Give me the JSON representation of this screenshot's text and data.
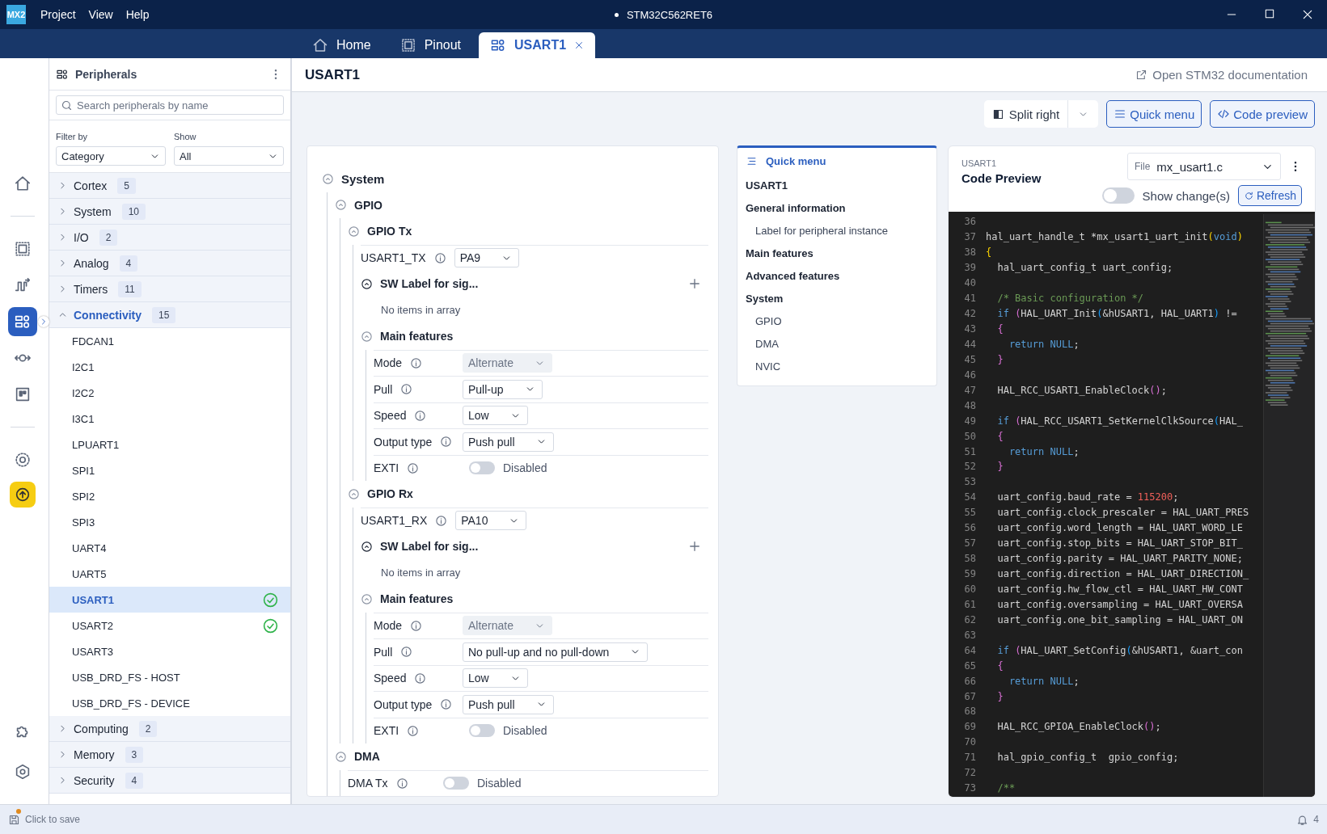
{
  "titlebar": {
    "logo": "MX2",
    "menu": [
      "Project",
      "View",
      "Help"
    ],
    "unsaved": true,
    "title": "STM32C562RET6"
  },
  "tabs": [
    {
      "label": "Home",
      "kind": "home",
      "selected": false,
      "closable": false
    },
    {
      "label": "Pinout",
      "kind": "chip",
      "selected": false,
      "closable": false
    },
    {
      "label": "USART1",
      "kind": "blocks",
      "selected": true,
      "closable": true
    }
  ],
  "rail": {
    "top": [
      {
        "kind": "home",
        "selected": false
      }
    ],
    "middle": [
      {
        "kind": "chip",
        "selected": false
      },
      {
        "kind": "wave",
        "selected": false
      },
      {
        "kind": "blocks",
        "selected": true
      },
      {
        "kind": "connector",
        "selected": false
      },
      {
        "kind": "board",
        "selected": false
      }
    ],
    "tools": [
      {
        "kind": "gear",
        "selected": false
      },
      {
        "kind": "upload",
        "selected": false
      }
    ],
    "bottom": [
      {
        "kind": "puzzle",
        "selected": false
      },
      {
        "kind": "hexagon",
        "selected": false
      }
    ]
  },
  "peripherals": {
    "title": "Peripherals",
    "search": {
      "placeholder": "Search peripherals by name"
    },
    "filter_by": {
      "label": "Filter by",
      "value": "Category"
    },
    "show": {
      "label": "Show",
      "value": "All"
    },
    "categories": [
      {
        "label": "Cortex",
        "count": "5",
        "expanded": false
      },
      {
        "label": "System",
        "count": "10",
        "expanded": false
      },
      {
        "label": "I/O",
        "count": "2",
        "expanded": false
      },
      {
        "label": "Analog",
        "count": "4",
        "expanded": false
      },
      {
        "label": "Timers",
        "count": "11",
        "expanded": false
      },
      {
        "label": "Connectivity",
        "count": "15",
        "expanded": true,
        "children": [
          {
            "label": "FDCAN1",
            "selected": false,
            "configured": false
          },
          {
            "label": "I2C1",
            "selected": false,
            "configured": false
          },
          {
            "label": "I2C2",
            "selected": false,
            "configured": false
          },
          {
            "label": "I3C1",
            "selected": false,
            "configured": false
          },
          {
            "label": "LPUART1",
            "selected": false,
            "configured": false
          },
          {
            "label": "SPI1",
            "selected": false,
            "configured": false
          },
          {
            "label": "SPI2",
            "selected": false,
            "configured": false
          },
          {
            "label": "SPI3",
            "selected": false,
            "configured": false
          },
          {
            "label": "UART4",
            "selected": false,
            "configured": false
          },
          {
            "label": "UART5",
            "selected": false,
            "configured": false
          },
          {
            "label": "USART1",
            "selected": true,
            "configured": true
          },
          {
            "label": "USART2",
            "selected": false,
            "configured": true
          },
          {
            "label": "USART3",
            "selected": false,
            "configured": false
          },
          {
            "label": "USB_DRD_FS - HOST",
            "selected": false,
            "configured": false
          },
          {
            "label": "USB_DRD_FS - DEVICE",
            "selected": false,
            "configured": false
          }
        ]
      },
      {
        "label": "Computing",
        "count": "2",
        "expanded": false
      },
      {
        "label": "Memory",
        "count": "3",
        "expanded": false
      },
      {
        "label": "Security",
        "count": "4",
        "expanded": false
      }
    ]
  },
  "page": {
    "title": "USART1",
    "doc_link": "Open STM32 documentation"
  },
  "toolbar": {
    "split": "Split right",
    "quick_menu": "Quick menu",
    "code_preview": "Code preview"
  },
  "config_tree": [
    {
      "kind": "group",
      "label": "System",
      "expanded": true,
      "children": [
        {
          "kind": "group",
          "label": "GPIO",
          "expanded": true,
          "children": [
            {
              "kind": "group",
              "label": "GPIO Tx",
              "expanded": true,
              "children": [
                {
                  "kind": "select",
                  "label": "USART1_TX",
                  "value": "PA9",
                  "disabled": false
                },
                {
                  "kind": "array",
                  "label": "SW Label for sig...",
                  "expanded": true,
                  "empty_text": "No items in array"
                },
                {
                  "kind": "group",
                  "label": "Main features",
                  "expanded": true,
                  "children": [
                    {
                      "kind": "select",
                      "label": "Mode",
                      "value": "Alternate",
                      "disabled": true
                    },
                    {
                      "kind": "select",
                      "label": "Pull",
                      "value": "Pull-up",
                      "disabled": false
                    },
                    {
                      "kind": "select",
                      "label": "Speed",
                      "value": "Low",
                      "disabled": false
                    },
                    {
                      "kind": "select",
                      "label": "Output type",
                      "value": "Push pull",
                      "disabled": false
                    },
                    {
                      "kind": "toggle",
                      "label": "EXTI",
                      "on": false,
                      "state_text": "Disabled"
                    }
                  ]
                }
              ]
            },
            {
              "kind": "group",
              "label": "GPIO Rx",
              "expanded": true,
              "children": [
                {
                  "kind": "select",
                  "label": "USART1_RX",
                  "value": "PA10",
                  "disabled": false
                },
                {
                  "kind": "array",
                  "label": "SW Label for sig...",
                  "expanded": true,
                  "empty_text": "No items in array"
                },
                {
                  "kind": "group",
                  "label": "Main features",
                  "expanded": true,
                  "children": [
                    {
                      "kind": "select",
                      "label": "Mode",
                      "value": "Alternate",
                      "disabled": true
                    },
                    {
                      "kind": "select",
                      "label": "Pull",
                      "value": "No pull-up and no pull-down",
                      "disabled": false
                    },
                    {
                      "kind": "select",
                      "label": "Speed",
                      "value": "Low",
                      "disabled": false
                    },
                    {
                      "kind": "select",
                      "label": "Output type",
                      "value": "Push pull",
                      "disabled": false
                    },
                    {
                      "kind": "toggle",
                      "label": "EXTI",
                      "on": false,
                      "state_text": "Disabled"
                    }
                  ]
                }
              ]
            }
          ]
        },
        {
          "kind": "group",
          "label": "DMA",
          "expanded": true,
          "children": [
            {
              "kind": "toggle",
              "label": "DMA Tx",
              "on": false,
              "state_text": "Disabled"
            }
          ]
        }
      ]
    }
  ],
  "quick_menu": {
    "title": "Quick menu",
    "items": [
      {
        "label": "USART1"
      },
      {
        "label": "General information",
        "children": [
          {
            "label": "Label for peripheral instance"
          }
        ]
      },
      {
        "label": "Main features"
      },
      {
        "label": "Advanced features"
      },
      {
        "label": "System",
        "children": [
          {
            "label": "GPIO"
          },
          {
            "label": "DMA"
          },
          {
            "label": "NVIC"
          }
        ]
      }
    ]
  },
  "code_preview": {
    "peripheral": "USART1",
    "title": "Code Preview",
    "file": {
      "label": "File",
      "value": "mx_usart1.c"
    },
    "show_changes": {
      "label": "Show change(s)",
      "on": false
    },
    "refresh": "Refresh",
    "lines": [
      {
        "number": "36"
      },
      {
        "number": "37",
        "segments": [
          {
            "kind": "plain",
            "text": "hal_uart_handle_t *mx_usart1_uart_init"
          },
          {
            "kind": "bracket1",
            "text": "("
          },
          {
            "kind": "keyword",
            "text": "void"
          },
          {
            "kind": "bracket1",
            "text": ")"
          }
        ]
      },
      {
        "number": "38",
        "segments": [
          {
            "kind": "bracket1",
            "text": "{"
          }
        ]
      },
      {
        "number": "39",
        "segments": [
          {
            "kind": "plain",
            "text": "  hal_uart_config_t uart_config;"
          }
        ]
      },
      {
        "number": "40"
      },
      {
        "number": "41",
        "segments": [
          {
            "kind": "comment",
            "text": "  /* Basic configuration */"
          }
        ]
      },
      {
        "number": "42",
        "segments": [
          {
            "kind": "keyword",
            "text": "  if "
          },
          {
            "kind": "bracket2",
            "text": "("
          },
          {
            "kind": "plain",
            "text": "HAL_UART_Init"
          },
          {
            "kind": "bracket3",
            "text": "("
          },
          {
            "kind": "plain",
            "text": "&hUSART1, HAL_UART1"
          },
          {
            "kind": "bracket3",
            "text": ")"
          },
          {
            "kind": "plain",
            "text": " !="
          }
        ]
      },
      {
        "number": "43",
        "segments": [
          {
            "kind": "bracket2",
            "text": "  {"
          }
        ]
      },
      {
        "number": "44",
        "segments": [
          {
            "kind": "keyword",
            "text": "    return NULL"
          },
          {
            "kind": "plain",
            "text": ";"
          }
        ]
      },
      {
        "number": "45",
        "segments": [
          {
            "kind": "bracket2",
            "text": "  }"
          }
        ]
      },
      {
        "number": "46"
      },
      {
        "number": "47",
        "segments": [
          {
            "kind": "plain",
            "text": "  HAL_RCC_USART1_EnableClock"
          },
          {
            "kind": "bracket2",
            "text": "()"
          },
          {
            "kind": "plain",
            "text": ";"
          }
        ]
      },
      {
        "number": "48"
      },
      {
        "number": "49",
        "segments": [
          {
            "kind": "keyword",
            "text": "  if "
          },
          {
            "kind": "bracket2",
            "text": "("
          },
          {
            "kind": "plain",
            "text": "HAL_RCC_USART1_SetKernelClkSource"
          },
          {
            "kind": "bracket3",
            "text": "("
          },
          {
            "kind": "plain",
            "text": "HAL_"
          }
        ]
      },
      {
        "number": "50",
        "segments": [
          {
            "kind": "bracket2",
            "text": "  {"
          }
        ]
      },
      {
        "number": "51",
        "segments": [
          {
            "kind": "keyword",
            "text": "    return NULL"
          },
          {
            "kind": "plain",
            "text": ";"
          }
        ]
      },
      {
        "number": "52",
        "segments": [
          {
            "kind": "bracket2",
            "text": "  }"
          }
        ]
      },
      {
        "number": "53"
      },
      {
        "number": "54",
        "segments": [
          {
            "kind": "plain",
            "text": "  uart_config.baud_rate = "
          },
          {
            "kind": "number",
            "text": "115200"
          },
          {
            "kind": "plain",
            "text": ";"
          }
        ]
      },
      {
        "number": "55",
        "segments": [
          {
            "kind": "plain",
            "text": "  uart_config.clock_prescaler = HAL_UART_PRES"
          }
        ]
      },
      {
        "number": "56",
        "segments": [
          {
            "kind": "plain",
            "text": "  uart_config.word_length = HAL_UART_WORD_LE"
          }
        ]
      },
      {
        "number": "57",
        "segments": [
          {
            "kind": "plain",
            "text": "  uart_config.stop_bits = HAL_UART_STOP_BIT_"
          }
        ]
      },
      {
        "number": "58",
        "segments": [
          {
            "kind": "plain",
            "text": "  uart_config.parity = HAL_UART_PARITY_NONE;"
          }
        ]
      },
      {
        "number": "59",
        "segments": [
          {
            "kind": "plain",
            "text": "  uart_config.direction = HAL_UART_DIRECTION_"
          }
        ]
      },
      {
        "number": "60",
        "segments": [
          {
            "kind": "plain",
            "text": "  uart_config.hw_flow_ctl = HAL_UART_HW_CONT"
          }
        ]
      },
      {
        "number": "61",
        "segments": [
          {
            "kind": "plain",
            "text": "  uart_config.oversampling = HAL_UART_OVERSA"
          }
        ]
      },
      {
        "number": "62",
        "segments": [
          {
            "kind": "plain",
            "text": "  uart_config.one_bit_sampling = HAL_UART_ON"
          }
        ]
      },
      {
        "number": "63"
      },
      {
        "number": "64",
        "segments": [
          {
            "kind": "keyword",
            "text": "  if "
          },
          {
            "kind": "bracket2",
            "text": "("
          },
          {
            "kind": "plain",
            "text": "HAL_UART_SetConfig"
          },
          {
            "kind": "bracket3",
            "text": "("
          },
          {
            "kind": "plain",
            "text": "&hUSART1, &uart_con"
          }
        ]
      },
      {
        "number": "65",
        "segments": [
          {
            "kind": "bracket2",
            "text": "  {"
          }
        ]
      },
      {
        "number": "66",
        "segments": [
          {
            "kind": "keyword",
            "text": "    return NULL"
          },
          {
            "kind": "plain",
            "text": ";"
          }
        ]
      },
      {
        "number": "67",
        "segments": [
          {
            "kind": "bracket2",
            "text": "  }"
          }
        ]
      },
      {
        "number": "68"
      },
      {
        "number": "69",
        "segments": [
          {
            "kind": "plain",
            "text": "  HAL_RCC_GPIOA_EnableClock"
          },
          {
            "kind": "bracket2",
            "text": "()"
          },
          {
            "kind": "plain",
            "text": ";"
          }
        ]
      },
      {
        "number": "70"
      },
      {
        "number": "71",
        "segments": [
          {
            "kind": "plain",
            "text": "  hal_gpio_config_t  gpio_config;"
          }
        ]
      },
      {
        "number": "72"
      },
      {
        "number": "73",
        "segments": [
          {
            "kind": "comment",
            "text": "  /**"
          }
        ]
      }
    ]
  },
  "status_bar": {
    "unsaved": true,
    "save_text": "Click to save",
    "notifications": "4"
  }
}
